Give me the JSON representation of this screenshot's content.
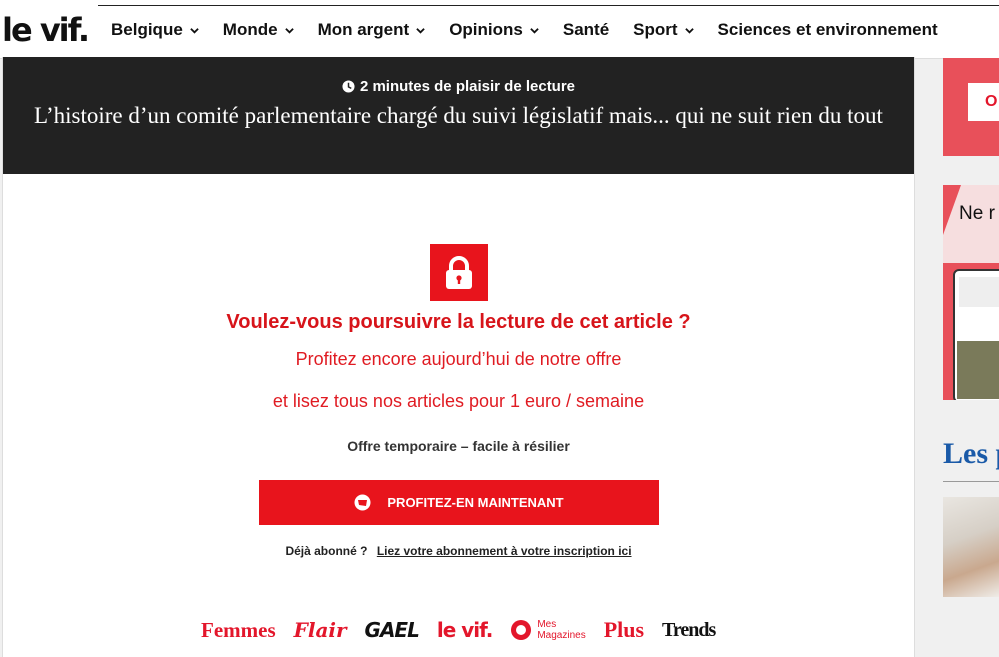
{
  "site": {
    "logo": "le vif."
  },
  "nav": {
    "items": [
      {
        "label": "Belgique",
        "has_dropdown": true
      },
      {
        "label": "Monde",
        "has_dropdown": true
      },
      {
        "label": "Mon argent",
        "has_dropdown": true
      },
      {
        "label": "Opinions",
        "has_dropdown": true
      },
      {
        "label": "Santé",
        "has_dropdown": false
      },
      {
        "label": "Sport",
        "has_dropdown": true
      },
      {
        "label": "Sciences et environnement",
        "has_dropdown": false
      }
    ]
  },
  "article": {
    "read_time": "2 minutes de plaisir de lecture",
    "title": "L’histoire d’un comité parlementaire chargé du suivi législatif mais... qui ne suit rien du tout"
  },
  "paywall": {
    "question": "Voulez-vous poursuivre la lecture de cet article ?",
    "offer_line1": "Profitez encore aujourd’hui de notre offre",
    "offer_line2": "et lisez tous nos articles pour 1 euro / semaine",
    "note": "Offre temporaire – facile à résilier",
    "cta_label": "PROFITEZ-EN MAINTENANT",
    "already_subscribed": "Déjà abonné ?",
    "link_label": "Liez votre abonnement à votre inscription ici"
  },
  "brands": {
    "femmes": "Femmes",
    "flair": "Flair",
    "gael": "GAEL",
    "levif": "le vif.",
    "mesmag_line1": "Mes",
    "mesmag_line2": "Magazines",
    "plus": "Plus",
    "trends": "Trends"
  },
  "rail": {
    "button_partial": "O",
    "ad_text_partial": "Ne r",
    "heading_partial": "Les p"
  },
  "colors": {
    "brand_red": "#e8141c",
    "hero_bg": "#222222",
    "rail_heading": "#1a5aa8"
  }
}
